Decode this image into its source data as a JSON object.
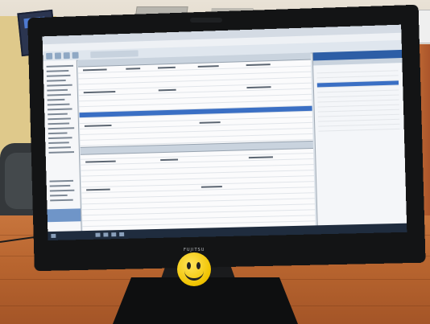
{
  "scene": {
    "description_tags": [
      "office",
      "desk",
      "monitor",
      "smiley-ball"
    ],
    "colors": {
      "desk": "#b8652f",
      "cabinet": "#cc7739",
      "bezel": "#131415",
      "app_accent": "#3a6fc4",
      "smiley": "#f0c300"
    }
  },
  "monitor": {
    "brand": "FUJITSU"
  },
  "screen": {
    "title": "",
    "clock": ""
  },
  "sticky_note": {
    "text": ""
  }
}
